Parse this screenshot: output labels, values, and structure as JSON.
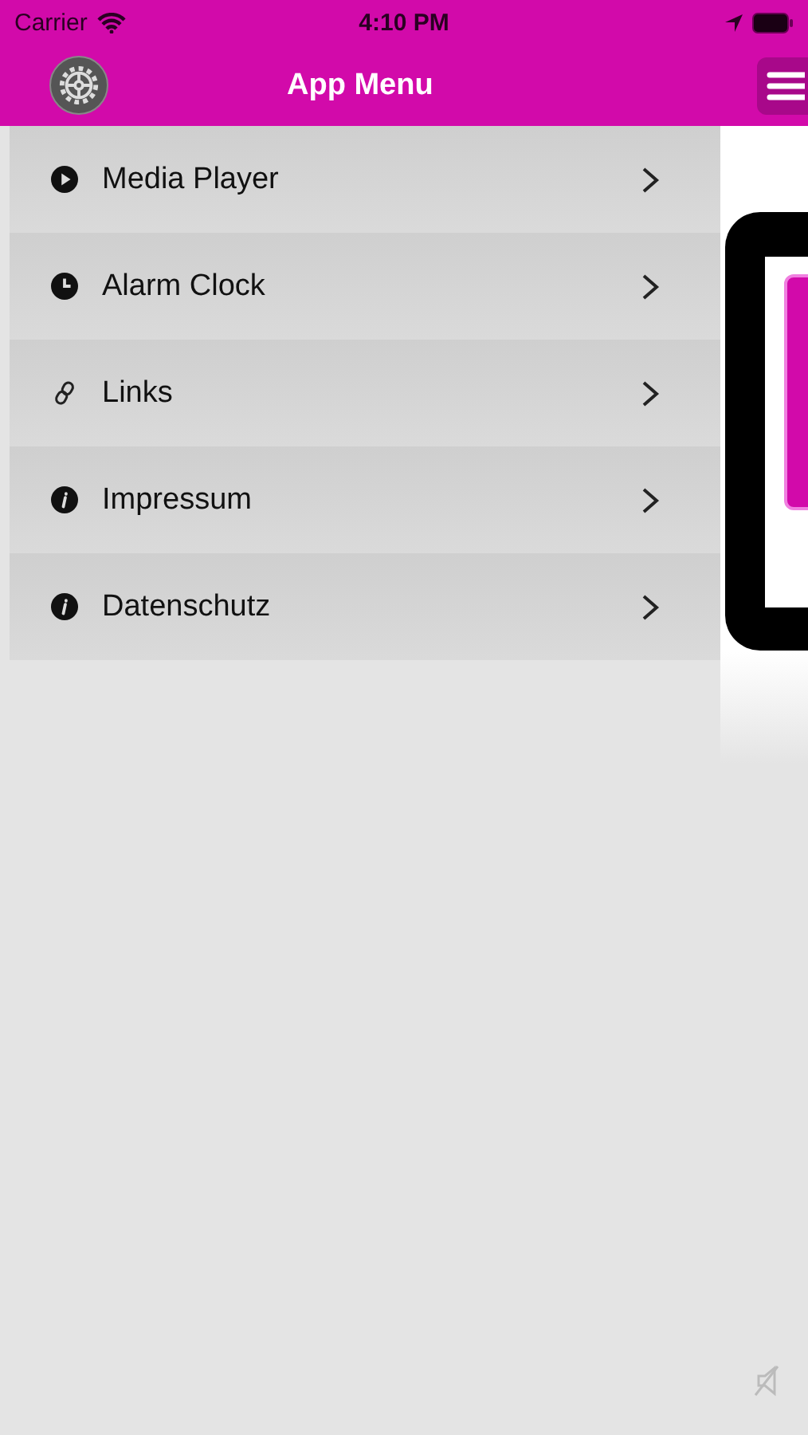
{
  "status_bar": {
    "carrier": "Carrier",
    "time": "4:10 PM"
  },
  "nav_bar": {
    "title": "App Menu"
  },
  "menu": {
    "items": [
      {
        "label": "Media Player",
        "kind": "play"
      },
      {
        "label": "Alarm Clock",
        "kind": "clock"
      },
      {
        "label": "Links",
        "kind": "link"
      },
      {
        "label": "Impressum",
        "kind": "info"
      },
      {
        "label": "Datenschutz",
        "kind": "info"
      }
    ]
  }
}
